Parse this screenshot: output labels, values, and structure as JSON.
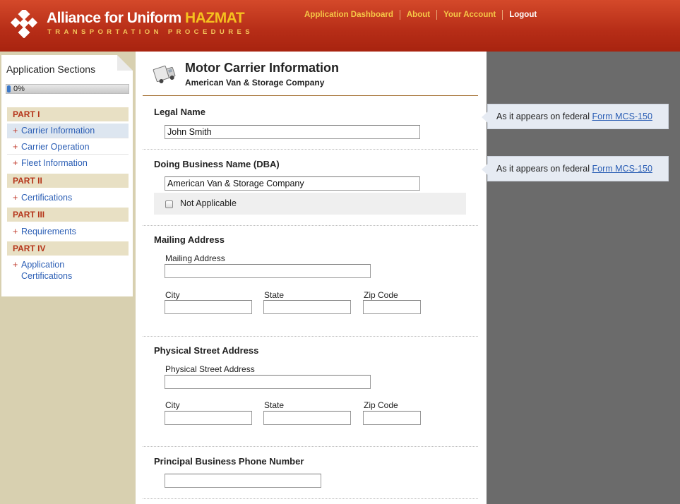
{
  "header": {
    "brand_main": "Alliance for Uniform ",
    "brand_hazmat": "HAZMAT",
    "tagline": "TRANSPORTATION PROCEDURES",
    "nav": [
      "Application Dashboard",
      "About",
      "Your Account",
      "Logout"
    ]
  },
  "sidebar": {
    "title": "Application Sections",
    "progress": "0%",
    "progress_value": 0,
    "parts": [
      {
        "label": "PART I",
        "items": [
          "Carrier Information",
          "Carrier Operation",
          "Fleet Information"
        ]
      },
      {
        "label": "PART II",
        "items": [
          "Certifications"
        ]
      },
      {
        "label": "PART III",
        "items": [
          "Requirements"
        ]
      },
      {
        "label": "PART IV",
        "items": [
          "Application Certifications"
        ]
      }
    ],
    "plus": "+"
  },
  "main": {
    "title": "Motor Carrier Information",
    "subtitle": "American Van & Storage Company",
    "legal_name": {
      "label": "Legal Name",
      "value": "John Smith"
    },
    "dba": {
      "label": "Doing Business Name (DBA)",
      "value": "American Van & Storage Company",
      "not_applicable": "Not Applicable"
    },
    "mailing": {
      "label": "Mailing Address",
      "address_label": "Mailing Address",
      "city": "City",
      "state": "State",
      "zip": "Zip Code"
    },
    "physical": {
      "label": "Physical Street Address",
      "address_label": "Physical Street Address",
      "city": "City",
      "state": "State",
      "zip": "Zip Code"
    },
    "phone": {
      "label": "Principal Business Phone Number"
    }
  },
  "tips": {
    "text": "As it appears on federal ",
    "link": "Form MCS-150"
  },
  "colors": {
    "header": "#b62d17",
    "accent": "#f5c11f",
    "link": "#2c5fb5",
    "part": "#b5351a"
  }
}
